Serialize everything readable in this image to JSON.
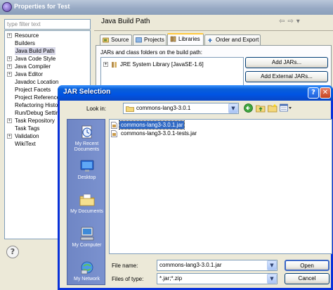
{
  "properties_window": {
    "title": "Properties for Test",
    "filter_placeholder": "type filter text",
    "tree_items": [
      {
        "label": "Resource",
        "expandable": true
      },
      {
        "label": "Builders",
        "expandable": false
      },
      {
        "label": "Java Build Path",
        "expandable": false,
        "selected": true
      },
      {
        "label": "Java Code Style",
        "expandable": true
      },
      {
        "label": "Java Compiler",
        "expandable": true
      },
      {
        "label": "Java Editor",
        "expandable": true
      },
      {
        "label": "Javadoc Location",
        "expandable": false
      },
      {
        "label": "Project Facets",
        "expandable": false
      },
      {
        "label": "Project Reference",
        "expandable": false
      },
      {
        "label": "Refactoring Histor",
        "expandable": false
      },
      {
        "label": "Run/Debug Settin",
        "expandable": false
      },
      {
        "label": "Task Repository",
        "expandable": true
      },
      {
        "label": "Task Tags",
        "expandable": false
      },
      {
        "label": "Validation",
        "expandable": true
      },
      {
        "label": "WikiText",
        "expandable": false
      }
    ],
    "section_title": "Java Build Path",
    "tabs": [
      {
        "label": "Source"
      },
      {
        "label": "Projects"
      },
      {
        "label": "Libraries",
        "active": true
      },
      {
        "label": "Order and Export"
      }
    ],
    "jars_label": "JARs and class folders on the build path:",
    "library_entry": "JRE System Library [JavaSE-1.6]",
    "add_jars_button": "Add JARs...",
    "add_external_jars_button": "Add External JARs..."
  },
  "jar_dialog": {
    "title": "JAR Selection",
    "help_button": "?",
    "close_button": "✕",
    "look_in_label": "Look in:",
    "look_in_value": "commons-lang3-3.0.1",
    "places": [
      {
        "label": "My Recent Documents",
        "icon": "recent-documents-icon"
      },
      {
        "label": "Desktop",
        "icon": "desktop-icon"
      },
      {
        "label": "My Documents",
        "icon": "my-documents-icon"
      },
      {
        "label": "My Computer",
        "icon": "my-computer-icon"
      },
      {
        "label": "My Network",
        "icon": "my-network-icon"
      }
    ],
    "files": [
      {
        "name": "commons-lang3-3.0.1.jar",
        "selected": true
      },
      {
        "name": "commons-lang3-3.0.1-tests.jar",
        "selected": false
      }
    ],
    "file_name_label": "File name:",
    "file_name_value": "commons-lang3-3.0.1.jar",
    "files_of_type_label": "Files of type:",
    "files_of_type_value": "*.jar;*.zip",
    "open_button": "Open",
    "cancel_button": "Cancel"
  },
  "colors": {
    "xp_title_blue": "#0054e3",
    "selection_blue": "#316ac5",
    "places_bar": "#7b92cf",
    "dialog_face": "#ece9d8"
  }
}
